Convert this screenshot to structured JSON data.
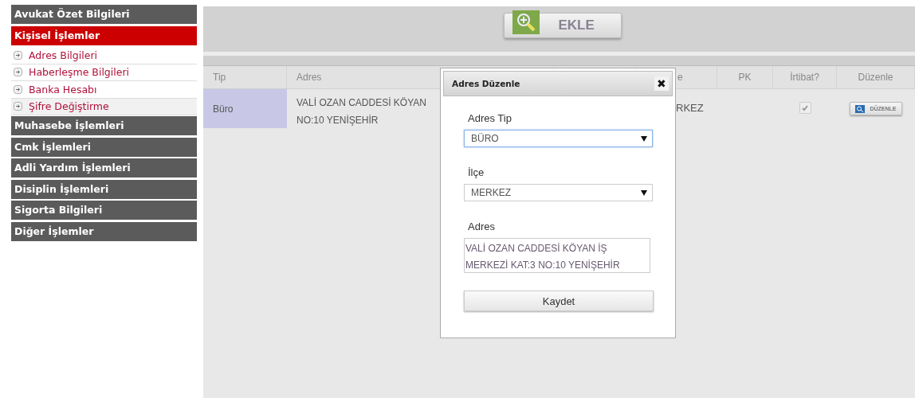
{
  "sidebar": {
    "sections": [
      {
        "title": "Avukat Özet Bilgileri",
        "selected": false
      },
      {
        "title": "Kişisel İşlemler",
        "selected": true,
        "items": [
          {
            "label": "Adres Bilgileri",
            "selected": false
          },
          {
            "label": "Haberleşme Bilgileri",
            "selected": false
          },
          {
            "label": "Banka Hesabı",
            "selected": false
          },
          {
            "label": "Şifre Değiştirme",
            "selected": true
          }
        ]
      },
      {
        "title": "Muhasebe İşlemleri",
        "selected": false
      },
      {
        "title": "Cmk İşlemleri",
        "selected": false
      },
      {
        "title": "Adli Yardım İşlemleri",
        "selected": false
      },
      {
        "title": "Disiplin İşlemleri",
        "selected": false
      },
      {
        "title": "Sigorta Bilgileri",
        "selected": false
      },
      {
        "title": "Diğer İşlemler",
        "selected": false
      }
    ]
  },
  "toolbar": {
    "add_button": "EKLE"
  },
  "table": {
    "columns": [
      "Tip",
      "Adres",
      "",
      "e",
      "PK",
      "İrtibat?",
      "Düzenle"
    ],
    "rows": [
      {
        "tip": "Büro",
        "adres_lines": [
          "VALİ OZAN CADDESİ KÖYAN",
          "NO:10 YENİŞEHİR"
        ],
        "column_4": "RKEZ",
        "irtibat_checked": true,
        "edit_button": "DÜZENLE"
      }
    ]
  },
  "dialog": {
    "title": "Adres Düzenle",
    "close": "✖",
    "fields": [
      {
        "kind": "select",
        "label": "Adres Tip",
        "value": "BÜRO",
        "focused": true
      },
      {
        "kind": "select",
        "label": "İlçe",
        "value": "MERKEZ",
        "focused": false
      },
      {
        "kind": "textarea",
        "label": "Adres",
        "value": "VALİ OZAN CADDESİ KÖYAN İŞ MERKEZİ KAT:3 NO:10 YENİŞEHİR",
        "focused": false
      }
    ],
    "save_button": "Kaydet"
  }
}
